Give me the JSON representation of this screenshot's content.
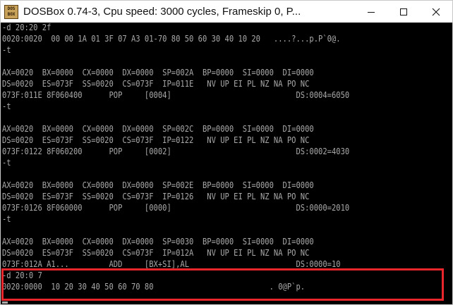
{
  "window": {
    "title": "DOSBox 0.74-3, Cpu speed:     3000 cycles, Frameskip  0, P...",
    "icon_label_top": "DOS",
    "icon_label_bottom": "BOX",
    "icons": {
      "app": "dosbox-icon",
      "minimize": "minimize-icon",
      "maximize": "maximize-icon",
      "close": "close-icon"
    }
  },
  "colors": {
    "console_bg": "#000000",
    "console_text": "#a8a8a8",
    "highlight": "#e8262b"
  },
  "console": {
    "lines": [
      "-d 20:20 2f",
      "0020:0020  00 00 1A 01 3F 07 A3 01-70 80 50 60 30 40 10 20   ....?...p.P`0@.",
      "-t",
      "",
      "AX=0020  BX=0000  CX=0000  DX=0000  SP=002A  BP=0000  SI=0000  DI=0000",
      "DS=0020  ES=073F  SS=0020  CS=073F  IP=011E   NV UP EI PL NZ NA PO NC",
      "073F:011E 8F060400      POP     [0004]                            DS:0004=6050",
      "-t",
      "",
      "AX=0020  BX=0000  CX=0000  DX=0000  SP=002C  BP=0000  SI=0000  DI=0000",
      "DS=0020  ES=073F  SS=0020  CS=073F  IP=0122   NV UP EI PL NZ NA PO NC",
      "073F:0122 8F060200      POP     [0002]                            DS:0002=4030",
      "-t",
      "",
      "AX=0020  BX=0000  CX=0000  DX=0000  SP=002E  BP=0000  SI=0000  DI=0000",
      "DS=0020  ES=073F  SS=0020  CS=073F  IP=0126   NV UP EI PL NZ NA PO NC",
      "073F:0126 8F060000      POP     [0000]                            DS:0000=2010",
      "-t",
      "",
      "AX=0020  BX=0000  CX=0000  DX=0000  SP=0030  BP=0000  SI=0000  DI=0000",
      "DS=0020  ES=073F  SS=0020  CS=073F  IP=012A   NV UP EI PL NZ NA PO NC",
      "073F:012A A1...         ADD     [BX+SI],AL                        DS:0000=10",
      "-d 20:0 7",
      "0020:0000  10 20 30 40 50 60 70 80                          . 0@P`p."
    ]
  }
}
